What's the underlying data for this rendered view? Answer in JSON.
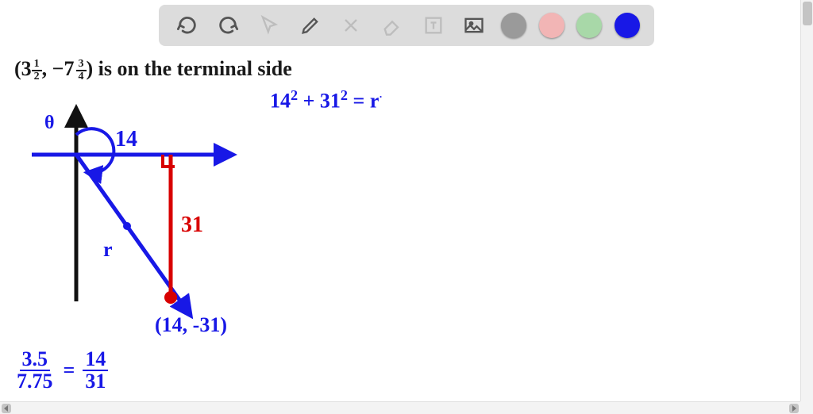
{
  "toolbar": {
    "tools": [
      {
        "name": "undo-icon"
      },
      {
        "name": "redo-icon"
      },
      {
        "name": "pointer-icon"
      },
      {
        "name": "pencil-icon"
      },
      {
        "name": "tools-icon"
      },
      {
        "name": "eraser-icon"
      },
      {
        "name": "text-tool-icon"
      },
      {
        "name": "image-tool-icon"
      }
    ],
    "colors": {
      "gray": "#9a9a9a",
      "pink": "#f2b5b5",
      "green": "#a8d8a8",
      "blue": "#1818e6"
    }
  },
  "text": {
    "problem_prefix": "(",
    "mixed_a_whole": "3",
    "mixed_a_num": "1",
    "mixed_a_den": "2",
    "comma": ", ",
    "neg": "−7",
    "mixed_b_num": "3",
    "mixed_b_den": "4",
    "problem_suffix": ") is on the terminal side",
    "pythag": "14² + 31² = r",
    "theta": "θ",
    "label_14": "14",
    "label_31": "31",
    "label_r": "r",
    "point": "(14, -31)",
    "frac_left_num": "3.5",
    "frac_left_den": "7.75",
    "eq": "=",
    "frac_right_num": "14",
    "frac_right_den": "31"
  },
  "chart_data": {
    "type": "diagram",
    "description": "Coordinate plane with a terminal-side ray in quadrant IV",
    "point_raw": {
      "x": 3.5,
      "y": -7.75
    },
    "point_scaled": {
      "x": 14,
      "y": -31
    },
    "triangle_legs": {
      "adjacent": 14,
      "opposite": 31
    },
    "equation": "14^2 + 31^2 = r^2",
    "ratio": {
      "lhs": [
        3.5,
        7.75
      ],
      "rhs": [
        14,
        31
      ]
    },
    "angle_symbol": "θ"
  }
}
